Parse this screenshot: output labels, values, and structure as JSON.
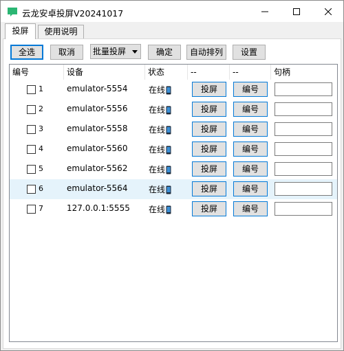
{
  "window": {
    "title": "云龙安卓投屏V20241017",
    "icon": "app-icon",
    "accent": "#0078d7"
  },
  "tabs": [
    {
      "label": "投屏",
      "selected": true
    },
    {
      "label": "使用说明",
      "selected": false
    }
  ],
  "toolbar": {
    "select_all_label": "全选",
    "cancel_label": "取消",
    "batch_dropdown_value": "批量投屏",
    "confirm_label": "确定",
    "auto_sort_label": "自动排列",
    "settings_label": "设置"
  },
  "columns": [
    "编号",
    "设备",
    "状态",
    "--",
    "--",
    "句柄"
  ],
  "rows": [
    {
      "index": "1",
      "device": "emulator-5554",
      "status": "在线",
      "cast_label": "投屏",
      "num_label": "编号",
      "handle": ""
    },
    {
      "index": "2",
      "device": "emulator-5556",
      "status": "在线",
      "cast_label": "投屏",
      "num_label": "编号",
      "handle": ""
    },
    {
      "index": "3",
      "device": "emulator-5558",
      "status": "在线",
      "cast_label": "投屏",
      "num_label": "编号",
      "handle": ""
    },
    {
      "index": "4",
      "device": "emulator-5560",
      "status": "在线",
      "cast_label": "投屏",
      "num_label": "编号",
      "handle": ""
    },
    {
      "index": "5",
      "device": "emulator-5562",
      "status": "在线",
      "cast_label": "投屏",
      "num_label": "编号",
      "handle": ""
    },
    {
      "index": "6",
      "device": "emulator-5564",
      "status": "在线",
      "cast_label": "投屏",
      "num_label": "编号",
      "handle": ""
    },
    {
      "index": "7",
      "device": "127.0.0.1:5555",
      "status": "在线",
      "cast_label": "投屏",
      "num_label": "编号",
      "handle": ""
    }
  ]
}
